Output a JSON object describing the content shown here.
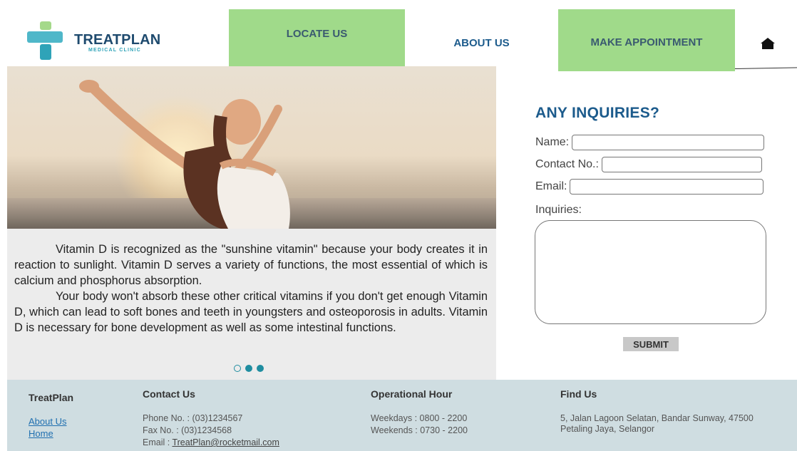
{
  "brand": {
    "name": "TREATPLAN",
    "tagline": "MEDICAL CLINIC"
  },
  "nav": {
    "locate": "LOCATE US",
    "about": "ABOUT US",
    "appointment": "MAKE APPOINTMENT"
  },
  "article": {
    "p1": "Vitamin D is recognized as the \"sunshine vitamin\" because your body creates it in reaction to sunlight. Vitamin D serves a variety of functions, the most essential of which is calcium and phosphorus absorption.",
    "p2": "Your body won't absorb these other critical vitamins if you don't get enough Vitamin D, which can lead to soft bones and teeth in youngsters and osteoporosis in adults. Vitamin D is necessary for bone development as well as some intestinal functions."
  },
  "carousel": {
    "active_index": 1,
    "count": 3
  },
  "form": {
    "title": "ANY INQUIRIES?",
    "name_label": "Name:",
    "name_value": "",
    "contact_label": "Contact No.:",
    "contact_value": "",
    "email_label": "Email:",
    "email_value": "",
    "inquiries_label": "Inquiries:",
    "inquiries_value": "",
    "submit_label": "SUBMIT"
  },
  "footer": {
    "brand_title": "TreatPlan",
    "links": [
      "About Us",
      "Home"
    ],
    "contact_title": "Contact Us",
    "phone": "Phone No. : (03)1234567",
    "fax": "Fax No. : (03)1234568",
    "email_prefix": "Email : ",
    "email": "TreatPlan@rocketmail.com",
    "hours_title": "Operational Hour",
    "weekdays": "Weekdays : 0800 - 2200",
    "weekends": "Weekends : 0730 - 2200",
    "find_title": "Find Us",
    "address": "5, Jalan Lagoon Selatan, Bandar Sunway, 47500 Petaling Jaya, Selangor"
  },
  "colors": {
    "nav_green": "#a0da8a",
    "brand_blue": "#1c5b8c",
    "accent_teal": "#1f8da0",
    "footer_bg": "#cfdde1"
  },
  "icons": {
    "home": "home-icon"
  }
}
